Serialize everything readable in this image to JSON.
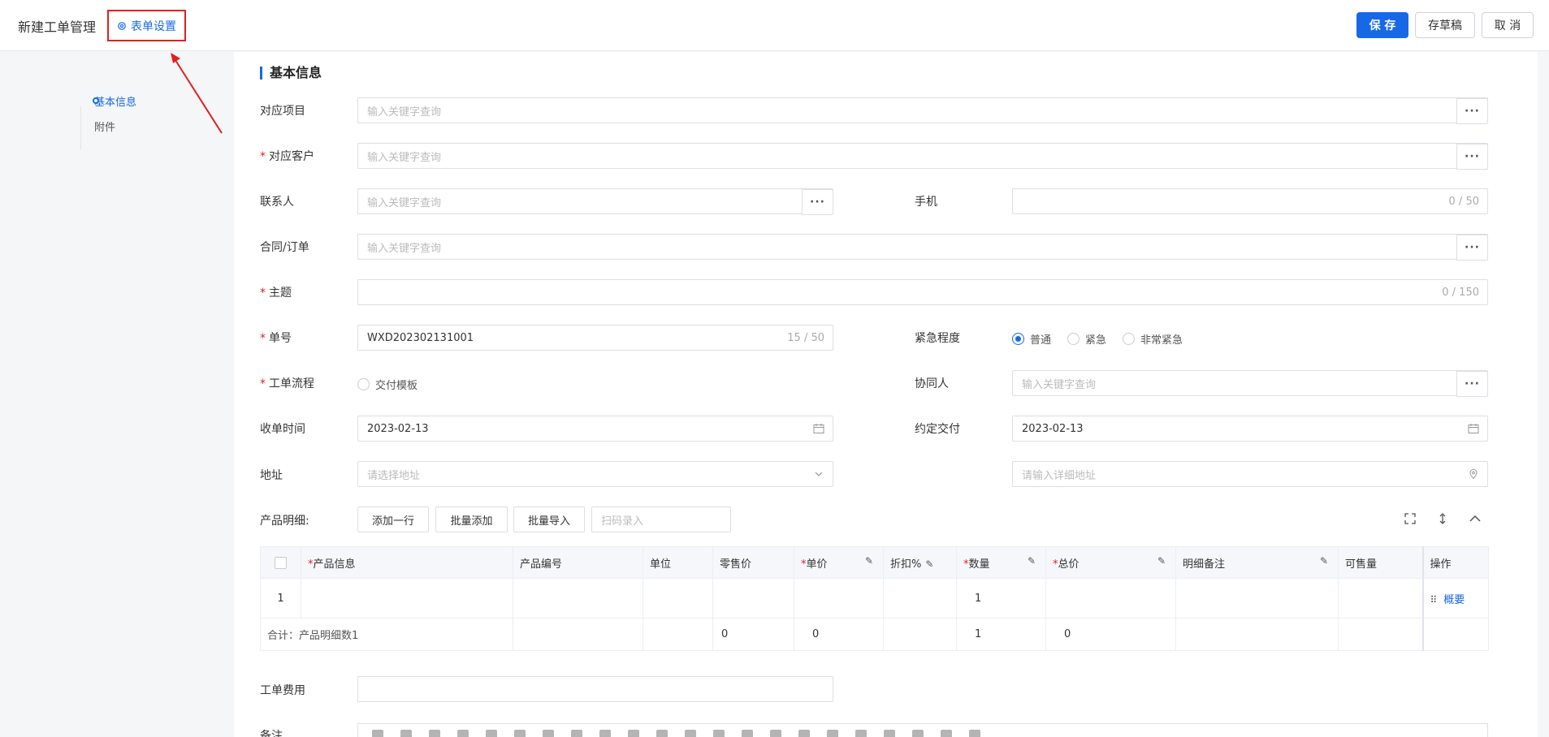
{
  "header": {
    "title": "新建工单管理",
    "settings_label": "表单设置",
    "save_label": "保 存",
    "draft_label": "存草稿",
    "cancel_label": "取 消"
  },
  "side_nav": [
    {
      "label": "基本信息",
      "active": true
    },
    {
      "label": "附件",
      "active": false
    }
  ],
  "section": {
    "title": "基本信息"
  },
  "form": {
    "project": {
      "label": "对应项目",
      "placeholder": "输入关键字查询"
    },
    "customer": {
      "label": "对应客户",
      "placeholder": "输入关键字查询"
    },
    "contact": {
      "label": "联系人",
      "placeholder": "输入关键字查询"
    },
    "mobile": {
      "label": "手机",
      "counter": "0 / 50"
    },
    "contract": {
      "label": "合同/订单",
      "placeholder": "输入关键字查询"
    },
    "subject": {
      "label": "主题",
      "counter": "0 / 150"
    },
    "order_no": {
      "label": "单号",
      "value": "WXD202302131001",
      "counter": "15 / 50"
    },
    "urgency": {
      "label": "紧急程度",
      "options": [
        "普通",
        "紧急",
        "非常紧急"
      ],
      "selected": "普通"
    },
    "workflow": {
      "label": "工单流程",
      "option": "交付模板"
    },
    "collaborator": {
      "label": "协同人",
      "placeholder": "输入关键字查询"
    },
    "receive_time": {
      "label": "收单时间",
      "value": "2023-02-13"
    },
    "delivery_time": {
      "label": "约定交付",
      "value": "2023-02-13"
    },
    "address": {
      "label": "地址",
      "placeholder": "请选择地址"
    },
    "address_detail": {
      "placeholder": "请输入详细地址"
    },
    "products": {
      "label": "产品明细:",
      "add_row": "添加一行",
      "batch_add": "批量添加",
      "batch_import": "批量导入",
      "scan_placeholder": "扫码录入"
    },
    "fee": {
      "label": "工单费用"
    },
    "remark": {
      "label": "备注"
    }
  },
  "table": {
    "columns": [
      "产品信息",
      "产品编号",
      "单位",
      "零售价",
      "单价",
      "折扣%",
      "数量",
      "总价",
      "明细备注",
      "可售量",
      "操作"
    ],
    "row": {
      "index": "1",
      "quantity": "1",
      "action": "概要"
    },
    "summary": {
      "label": "合计：产品明细数1",
      "retail": "0",
      "unit_price": "0",
      "quantity": "1",
      "total": "0"
    }
  },
  "colors": {
    "accent": "#1768e6",
    "required": "#e02020"
  }
}
